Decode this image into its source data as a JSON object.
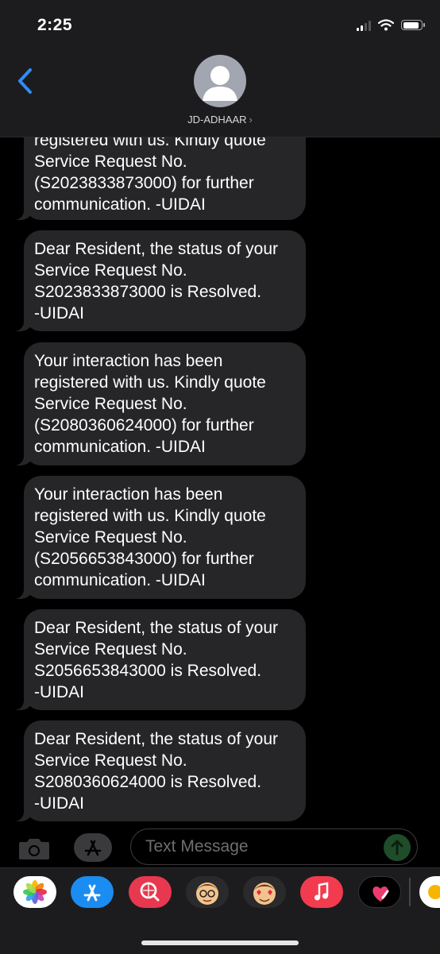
{
  "status_bar": {
    "time": "2:25"
  },
  "header": {
    "contact_name": "JD-ADHAAR",
    "chevron": "›"
  },
  "messages": [
    {
      "text": "registered with us. Kindly quote\nService Request No.\n(S2023833873000) for further\ncommunication. -UIDAI"
    },
    {
      "text": "Dear Resident, the status of your\nService Request No.\nS2023833873000 is Resolved.\n-UIDAI"
    },
    {
      "text": "Your interaction has been\nregistered with us. Kindly quote\nService Request No.\n(S2080360624000) for further\ncommunication. -UIDAI"
    },
    {
      "text": "Your interaction has been\nregistered with us. Kindly quote\nService Request No.\n(S2056653843000) for further\ncommunication. -UIDAI"
    },
    {
      "text": "Dear Resident, the status of your\nService Request No.\nS2056653843000 is Resolved.\n-UIDAI"
    },
    {
      "text": "Dear Resident, the status of your\nService Request No.\nS2080360624000 is Resolved.\n-UIDAI"
    }
  ],
  "input": {
    "placeholder": "Text Message"
  },
  "app_drawer": {
    "apps": [
      "photos-app-icon",
      "app-store-icon",
      "image-search-icon",
      "memoji-icon",
      "memoji-stickers-icon",
      "music-icon",
      "digital-touch-icon",
      "partial-app-icon"
    ]
  },
  "colors": {
    "background": "#000000",
    "bubble": "#262628",
    "header": "#1c1c1e",
    "accent": "#2f8cf6",
    "send": "#1f4d2a"
  }
}
